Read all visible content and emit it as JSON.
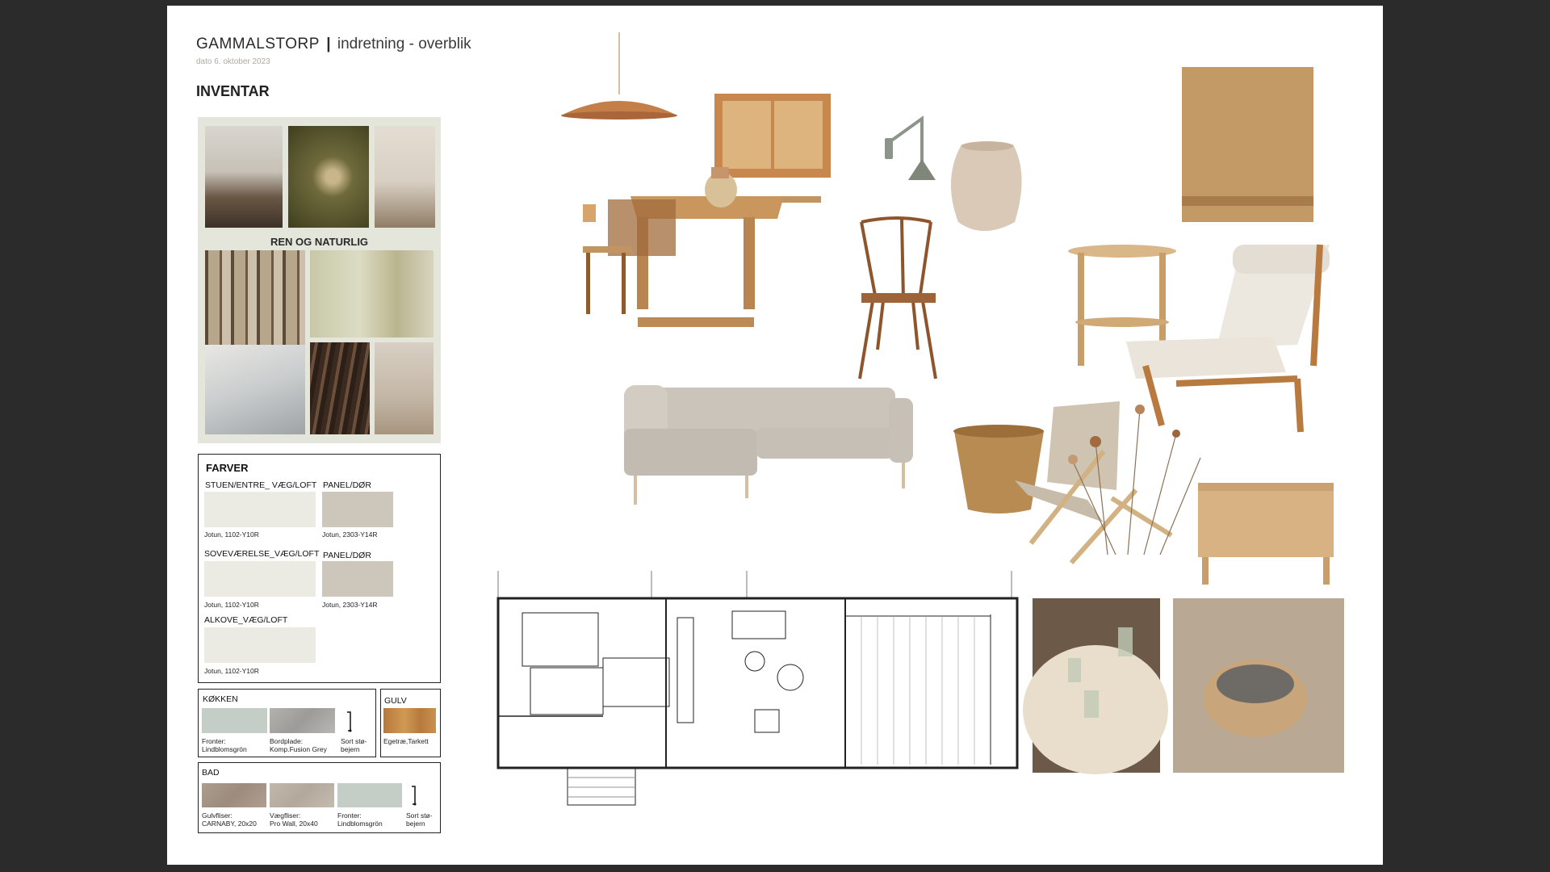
{
  "header": {
    "title_main": "GAMMALSTORP",
    "separator": "|",
    "title_sub": "indretning - overblik",
    "date": "dato 6. oktober 2023"
  },
  "section": {
    "title": "INVENTAR"
  },
  "moodboard": {
    "label": "REN OG NATURLIG"
  },
  "farver": {
    "title": "FARVER",
    "rows": [
      {
        "area": "STUEN/ENTRE_ VÆG/LOFT",
        "code": "Jotun, 1102-Y10R",
        "color": "#ebebe4",
        "panel_label": "PANEL/DØR",
        "panel_code": "Jotun, 2303-Y14R",
        "panel_color": "#cdc6bb"
      },
      {
        "area": "SOVEVÆRELSE_VÆG/LOFT",
        "code": "Jotun, 1102-Y10R",
        "color": "#ebebe4",
        "panel_label": "PANEL/DØR",
        "panel_code": "Jotun, 2303-Y14R",
        "panel_color": "#cdc6bb"
      },
      {
        "area": "ALKOVE_VÆG/LOFT",
        "code": "Jotun, 1102-Y10R",
        "color": "#ebebe4"
      }
    ]
  },
  "kokken": {
    "title": "KØKKEN",
    "items": [
      {
        "line1": "Fronter:",
        "line2": "Lindblomsgrön",
        "color": "#c4cdc6"
      },
      {
        "line1": "Bordplade:",
        "line2": "Komp.Fusion Grey",
        "color": "#a9a8a5"
      },
      {
        "line1": "Sort stø-",
        "line2": "bejern",
        "icon": "faucet-icon"
      }
    ]
  },
  "gulv": {
    "title": "GULV",
    "item": {
      "line1": "Egetræ,Tarkett",
      "color": "#c0873f"
    }
  },
  "bad": {
    "title": "BAD",
    "items": [
      {
        "line1": "Gulvfliser:",
        "line2": "CARNABY, 20x20",
        "color": "#a8988a"
      },
      {
        "line1": "Vægfliser:",
        "line2": "Pro Wall, 20x40",
        "color": "#bdb2a6"
      },
      {
        "line1": "Fronter:",
        "line2": "Lindblomsgrön",
        "color": "#c4cdc6"
      },
      {
        "line1": "Sort stø-",
        "line2": "bejern",
        "icon": "faucet-icon"
      }
    ]
  },
  "colors": {
    "background": "#2b2b2b",
    "page": "#ffffff",
    "wood": "#c08a55",
    "fabric": "#cfc8bf"
  }
}
